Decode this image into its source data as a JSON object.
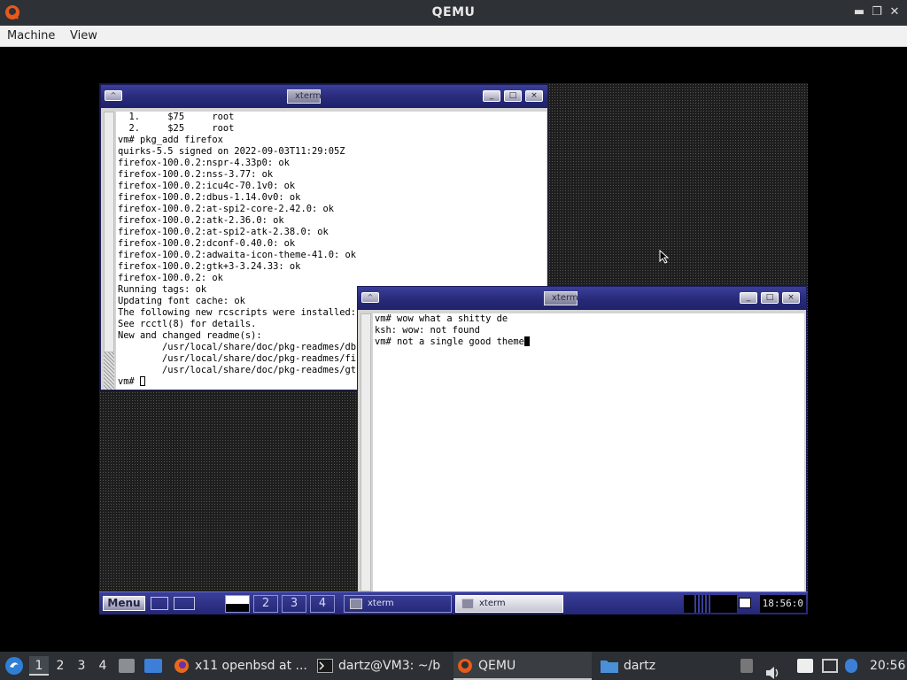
{
  "host": {
    "title": "QEMU",
    "menu": [
      "Machine",
      "View"
    ],
    "window_controls": {
      "minimize": "▬",
      "restore": "❐",
      "close": "✕"
    }
  },
  "xterm1": {
    "title": "xterm",
    "buttons": {
      "shade": "^",
      "minimize": "_",
      "maximize": "□",
      "close": "×"
    },
    "lines": [
      "  1.     $75     root",
      "  2.     $25     root",
      "vm# pkg_add firefox",
      "quirks-5.5 signed on 2022-09-03T11:29:05Z",
      "firefox-100.0.2:nspr-4.33p0: ok",
      "firefox-100.0.2:nss-3.77: ok",
      "firefox-100.0.2:icu4c-70.1v0: ok",
      "firefox-100.0.2:dbus-1.14.0v0: ok",
      "firefox-100.0.2:at-spi2-core-2.42.0: ok",
      "firefox-100.0.2:atk-2.36.0: ok",
      "firefox-100.0.2:at-spi2-atk-2.38.0: ok",
      "firefox-100.0.2:dconf-0.40.0: ok",
      "firefox-100.0.2:adwaita-icon-theme-41.0: ok",
      "firefox-100.0.2:gtk+3-3.24.33: ok",
      "firefox-100.0.2: ok",
      "Running tags: ok",
      "Updating font cache: ok",
      "The following new rcscripts were installed: /",
      "See rcctl(8) for details.",
      "New and changed readme(s):",
      "        /usr/local/share/doc/pkg-readmes/dbus",
      "        /usr/local/share/doc/pkg-readmes/fire",
      "        /usr/local/share/doc/pkg-readmes/gtk+"
    ],
    "prompt": "vm# "
  },
  "xterm2": {
    "title": "xterm",
    "buttons": {
      "shade": "^",
      "minimize": "_",
      "maximize": "□",
      "close": "×"
    },
    "lines": [
      "vm# wow what a shitty de",
      "ksh: wow: not found"
    ],
    "prompt_line": "vm# not a single good theme"
  },
  "fvwm_bar": {
    "menu_label": "Menu",
    "desks": [
      "2",
      "3",
      "4"
    ],
    "tasks": [
      {
        "label": "xterm",
        "active": false
      },
      {
        "label": "xterm",
        "active": true
      }
    ],
    "clock": "18:56:0"
  },
  "panel": {
    "workspaces": [
      "1",
      "2",
      "3",
      "4"
    ],
    "active_workspace": "1",
    "tasks": [
      {
        "label": "x11 openbsd at ..."
      },
      {
        "label": "dartz@VM3: ~/b"
      },
      {
        "label": "QEMU"
      },
      {
        "label": "dartz"
      }
    ],
    "clock": "20:56"
  }
}
